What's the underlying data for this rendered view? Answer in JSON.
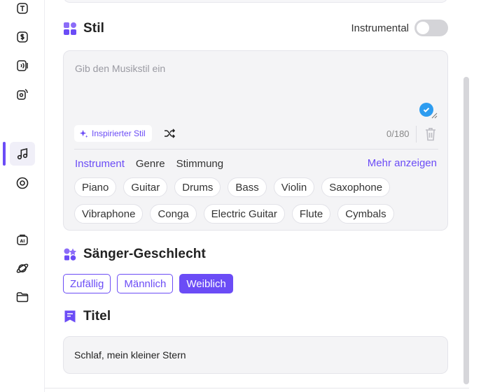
{
  "sidebar": {
    "items": [
      {
        "icon": "text-to-speech-icon"
      },
      {
        "icon": "dollar-audio-icon"
      },
      {
        "icon": "voice-wave-icon"
      },
      {
        "icon": "speaker-icon"
      },
      {
        "icon": "music-note-icon",
        "active": true
      },
      {
        "icon": "disc-icon"
      },
      {
        "icon": "ai-bag-icon"
      },
      {
        "icon": "planet-icon"
      },
      {
        "icon": "folder-icon"
      }
    ]
  },
  "style_section": {
    "title": "Stil",
    "instrumental_label": "Instrumental",
    "instrumental_on": false,
    "input_placeholder": "Gib den Musikstil ein",
    "inspire_label": "Inspirierter Stil",
    "counter": "0/180",
    "tabs": [
      "Instrument",
      "Genre",
      "Stimmung"
    ],
    "active_tab": "Instrument",
    "more_label": "Mehr anzeigen",
    "chips_row1": [
      "Piano",
      "Guitar",
      "Drums",
      "Bass",
      "Violin",
      "Saxophone"
    ],
    "chips_row2": [
      "Vibraphone",
      "Conga",
      "Electric Guitar",
      "Flute",
      "Cymbals"
    ]
  },
  "gender_section": {
    "title": "Sänger-Geschlecht",
    "options": [
      "Zufällig",
      "Männlich",
      "Weiblich"
    ],
    "selected": "Weiblich"
  },
  "title_section": {
    "title": "Titel",
    "value": "Schlaf, mein kleiner Stern"
  },
  "colors": {
    "accent": "#6b4cf6",
    "check": "#2d9cf0",
    "card_bg": "#f4f4f6"
  }
}
